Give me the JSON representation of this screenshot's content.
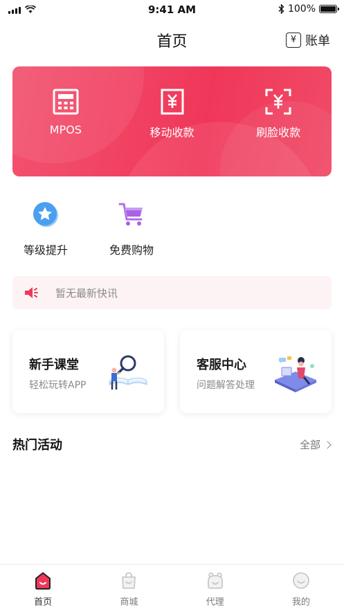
{
  "status_bar": {
    "time": "9:41 AM",
    "battery": "100%"
  },
  "header": {
    "title": "首页",
    "bill_icon_glyph": "¥",
    "bill_label": "账单"
  },
  "banner": {
    "items": [
      {
        "label": "MPOS",
        "icon": "calculator-icon"
      },
      {
        "label": "移动收款",
        "icon": "yuan-receipt-icon"
      },
      {
        "label": "刷脸收款",
        "icon": "face-scan-yuan-icon"
      }
    ],
    "gradient_colors": [
      "#f2536f",
      "#f0375a"
    ]
  },
  "quick_actions": [
    {
      "label": "等级提升",
      "icon": "star-badge-icon"
    },
    {
      "label": "免费购物",
      "icon": "shopping-cart-icon"
    }
  ],
  "notice": {
    "text": "暂无最新快讯",
    "icon": "megaphone-icon"
  },
  "cards": [
    {
      "title": "新手课堂",
      "subtitle": "轻松玩转APP",
      "illustration": "magnifier-book-illustration"
    },
    {
      "title": "客服中心",
      "subtitle": "问题解答处理",
      "illustration": "support-desk-illustration"
    }
  ],
  "section": {
    "title": "热门活动",
    "more_label": "全部"
  },
  "tab_bar": {
    "items": [
      {
        "label": "首页",
        "icon": "home-icon",
        "active": true
      },
      {
        "label": "商城",
        "icon": "bag-icon",
        "active": false
      },
      {
        "label": "代理",
        "icon": "agent-icon",
        "active": false
      },
      {
        "label": "我的",
        "icon": "profile-icon",
        "active": false
      }
    ]
  },
  "colors": {
    "accent": "#f0375a",
    "notice_bg": "#fdf3f5"
  }
}
